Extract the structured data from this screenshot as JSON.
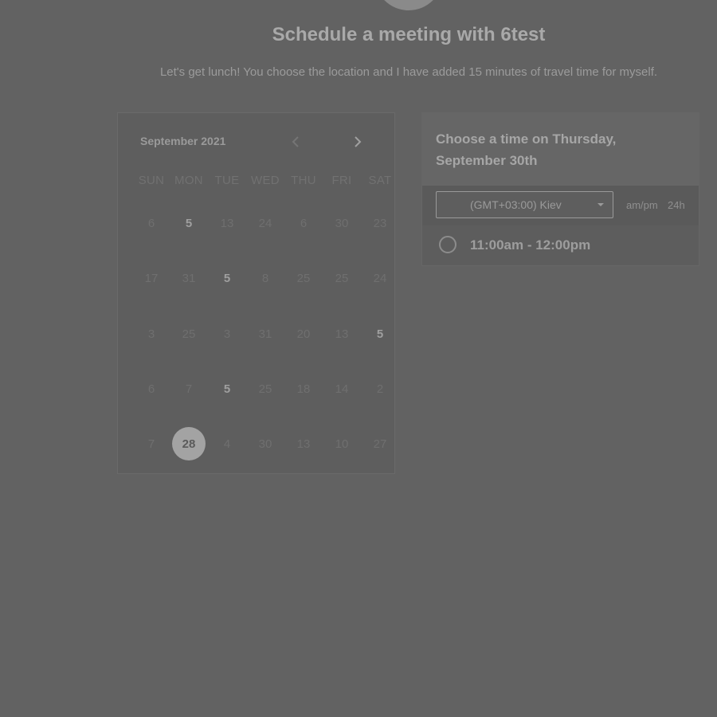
{
  "header": {
    "title": "Schedule a meeting with 6test",
    "subtitle": "Let's get lunch! You choose the location and I have added 15 minutes of travel time for myself."
  },
  "calendar": {
    "month_label": "September 2021",
    "prev_icon": "chevron-left-icon",
    "next_icon": "chevron-right-icon",
    "weekdays": [
      "SUN",
      "MON",
      "TUE",
      "WED",
      "THU",
      "FRI",
      "SAT"
    ],
    "weeks": [
      [
        "6",
        "5",
        "13",
        "24",
        "6",
        "30",
        "23"
      ],
      [
        "17",
        "31",
        "5",
        "8",
        "25",
        "25",
        "24"
      ],
      [
        "3",
        "25",
        "3",
        "31",
        "20",
        "13",
        "5"
      ],
      [
        "6",
        "7",
        "5",
        "25",
        "18",
        "14",
        "2"
      ],
      [
        "7",
        "28",
        "4",
        "30",
        "13",
        "10",
        "27"
      ]
    ],
    "available_days": [
      [
        0,
        1
      ],
      [
        1,
        2
      ],
      [
        2,
        6
      ],
      [
        3,
        2
      ]
    ],
    "selected_day": [
      4,
      1
    ],
    "selected_color": "#a3a3a3"
  },
  "time_panel": {
    "title": "Choose a time on Thursday, September 30th",
    "timezone": "(GMT+03:00) Kiev",
    "format_ampm": "am/pm",
    "format_24h": "24h",
    "slots": [
      {
        "label": "11:00am - 12:00pm",
        "selected": false
      }
    ]
  }
}
